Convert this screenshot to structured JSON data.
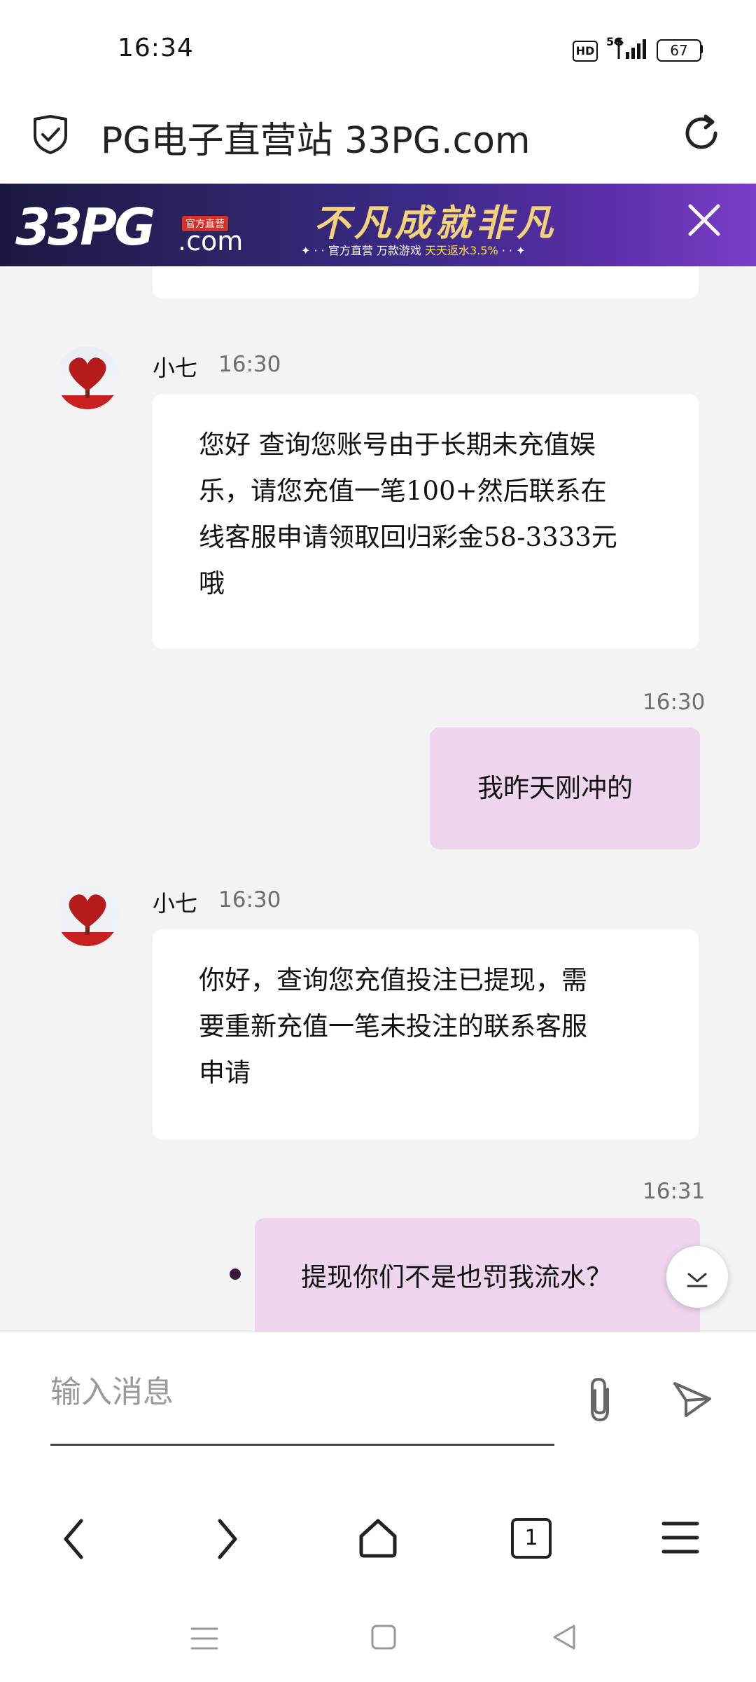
{
  "status_bar": {
    "time": "16:34",
    "hd": "HD",
    "network": "5G",
    "battery": "67"
  },
  "address_bar": {
    "title": "PG电子直营站 33PG.com"
  },
  "banner": {
    "logo_number": "33PG",
    "logo_tag": "官方直营",
    "logo_domain": ".com",
    "headline": "不凡成就非凡",
    "sub_prefix": "✦ · · 官方直营  万款游戏 ",
    "sub_highlight": "天天返水3.5%",
    "sub_suffix": " · · ✦"
  },
  "chat": {
    "messages": [
      {
        "direction": "in",
        "sender": "小七",
        "time": "16:30",
        "lines": [
          "您好 查询您账号由于长期未充值娱",
          "乐，请您充值一笔100+然后联系在",
          "线客服申请领取回归彩金58-3333元",
          "哦"
        ]
      },
      {
        "direction": "out",
        "time": "16:30",
        "text": "我昨天刚冲的"
      },
      {
        "direction": "in",
        "sender": "小七",
        "time": "16:30",
        "lines": [
          "你好，查询您充值投注已提现，需",
          "要重新充值一笔未投注的联系客服",
          "申请"
        ]
      },
      {
        "direction": "out",
        "time": "16:31",
        "text": "提现你们不是也罚我流水？"
      }
    ]
  },
  "input": {
    "placeholder": "输入消息"
  },
  "browser_nav": {
    "tab_count": "1"
  },
  "colors": {
    "outgoing_bubble": "#eed5ee",
    "incoming_bubble": "#ffffff",
    "chat_bg": "#f3f3f3"
  }
}
